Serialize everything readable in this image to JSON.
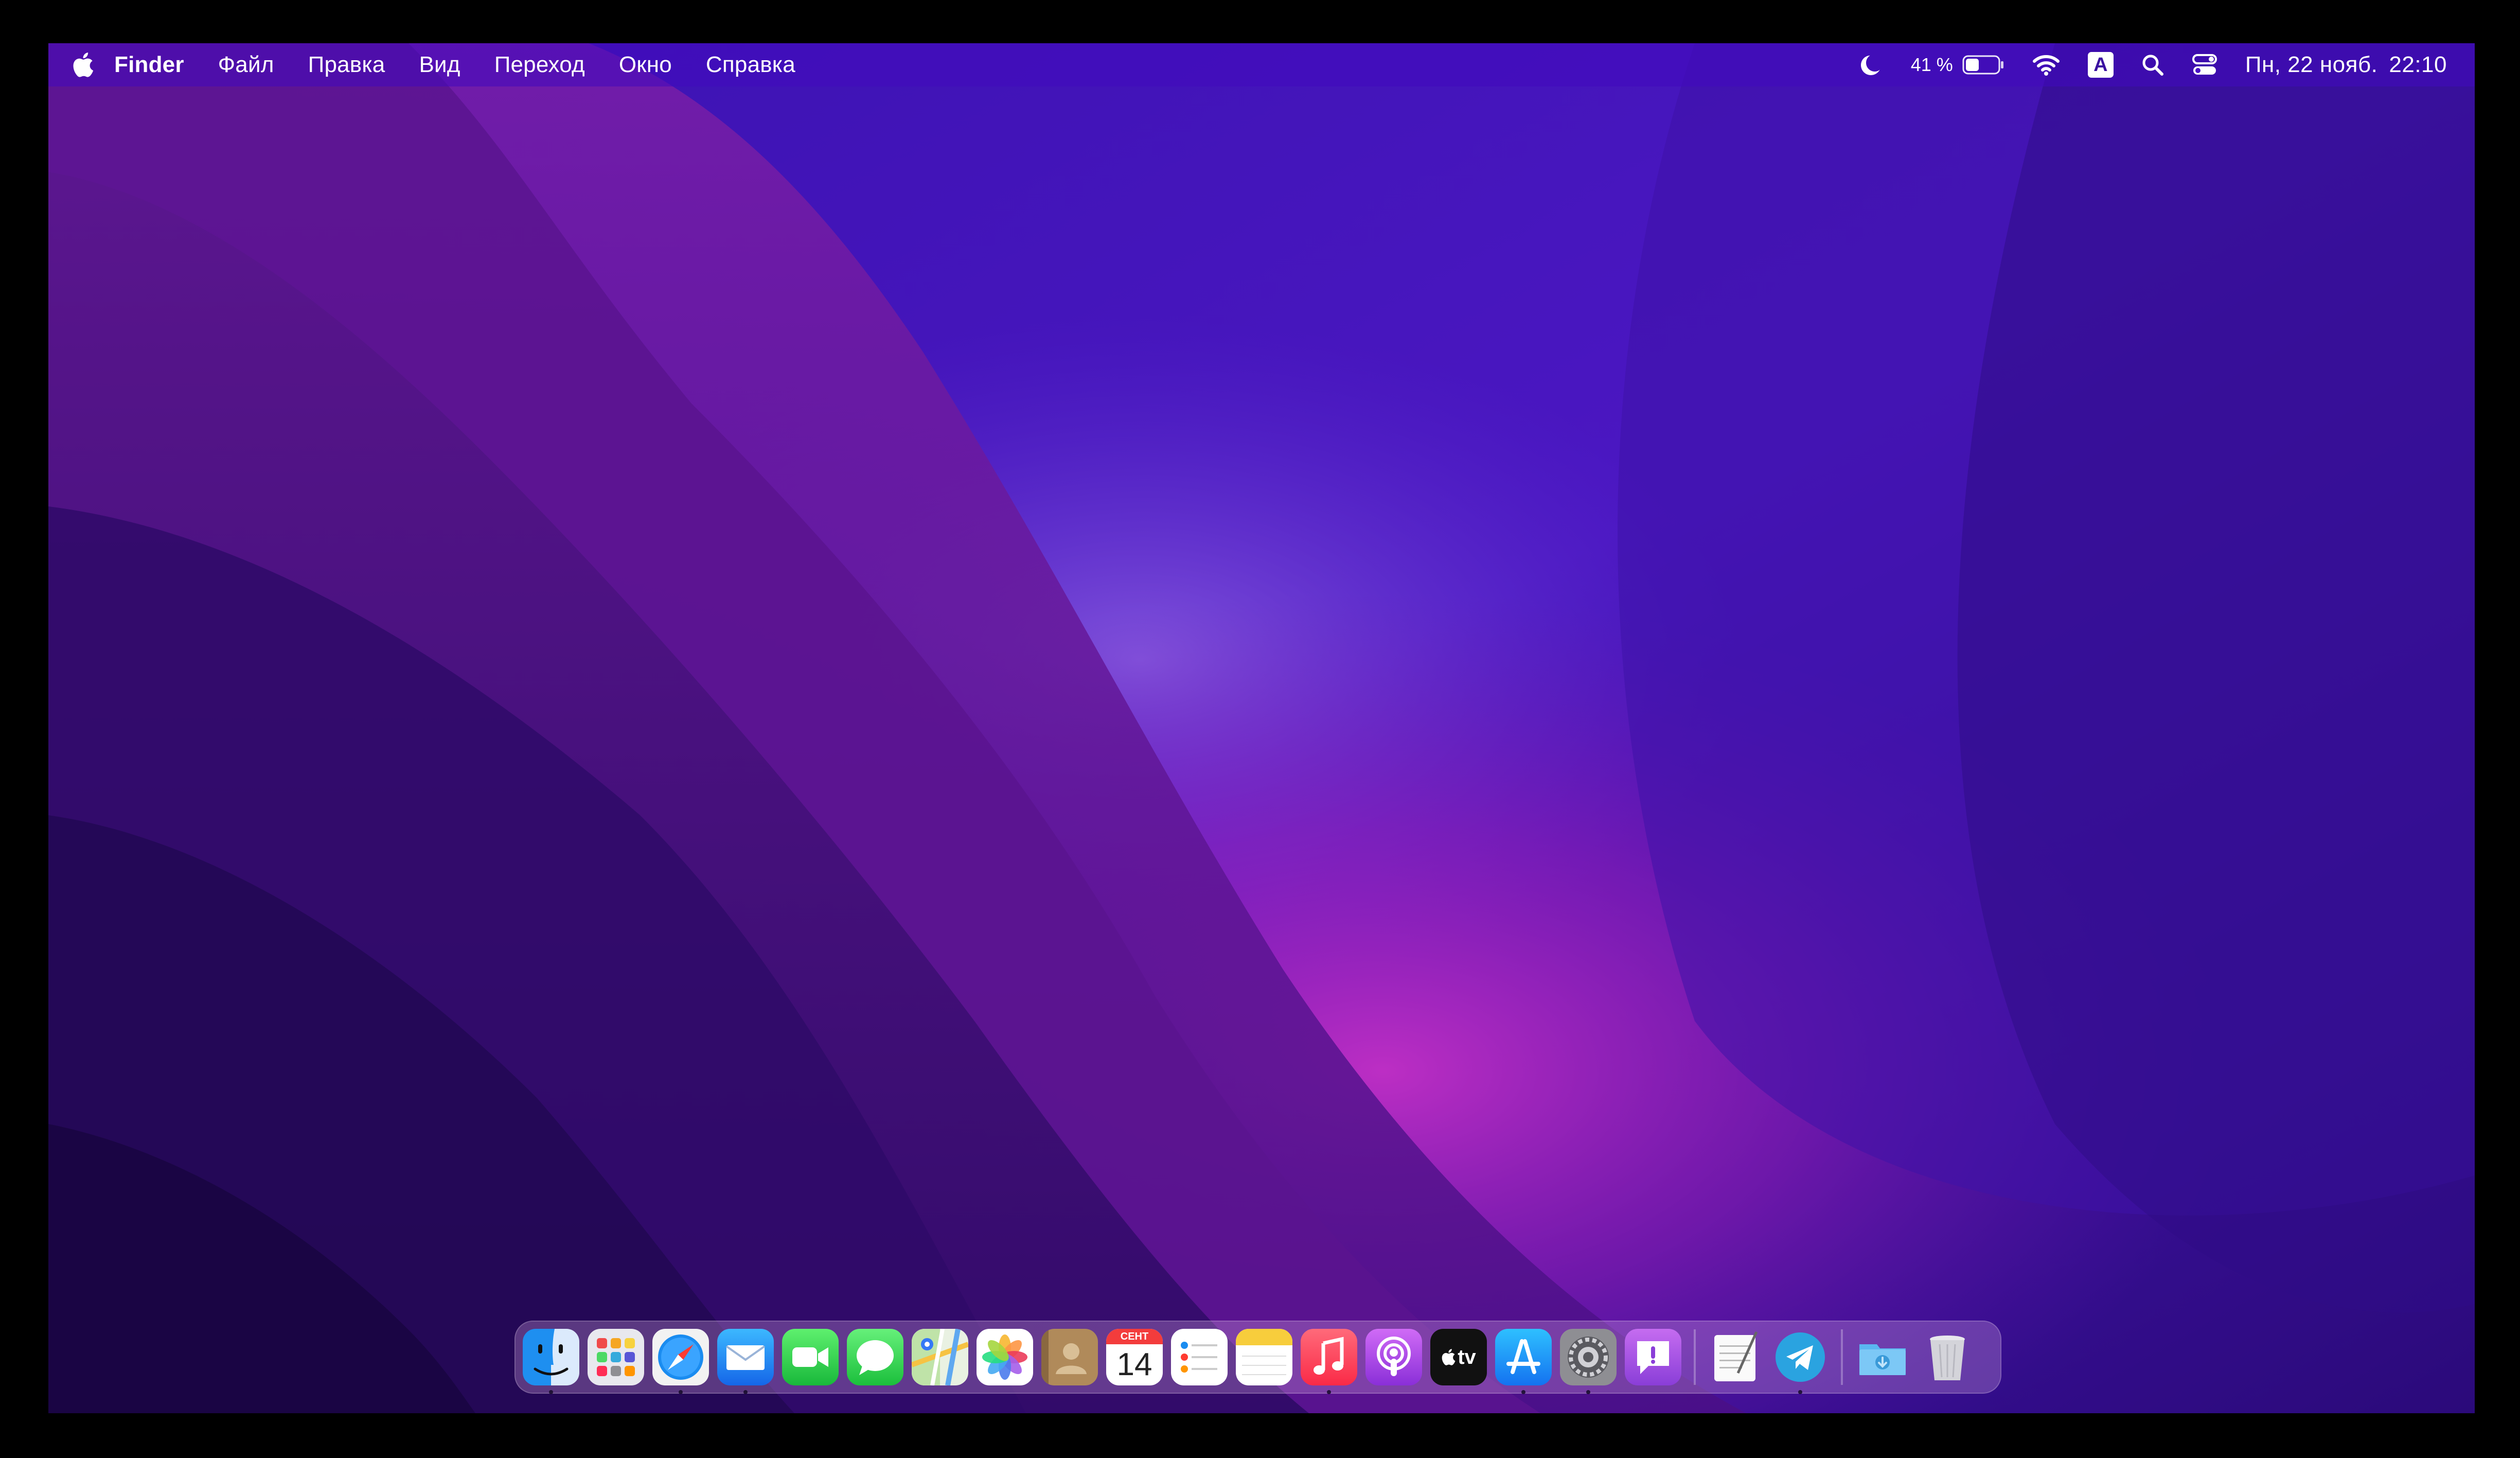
{
  "menubar": {
    "app_name": "Finder",
    "items": [
      "Файл",
      "Правка",
      "Вид",
      "Переход",
      "Окно",
      "Справка"
    ],
    "battery_percent": "41 %",
    "battery_level": 0.41,
    "input_source": "A",
    "date": "Пн, 22 нояб.",
    "time": "22:10"
  },
  "dock": {
    "calendar_month": "сент",
    "calendar_day": "14",
    "tv_label": "tv",
    "apps": [
      {
        "name": "Finder",
        "running": true
      },
      {
        "name": "Launchpad",
        "running": false
      },
      {
        "name": "Safari",
        "running": true
      },
      {
        "name": "Mail",
        "running": true
      },
      {
        "name": "FaceTime",
        "running": false
      },
      {
        "name": "Messages",
        "running": false
      },
      {
        "name": "Maps",
        "running": false
      },
      {
        "name": "Photos",
        "running": false
      },
      {
        "name": "Contacts",
        "running": false
      },
      {
        "name": "Calendar",
        "running": false
      },
      {
        "name": "Reminders",
        "running": false
      },
      {
        "name": "Notes",
        "running": false
      },
      {
        "name": "Music",
        "running": true
      },
      {
        "name": "Podcasts",
        "running": false
      },
      {
        "name": "TV",
        "running": false
      },
      {
        "name": "App Store",
        "running": true
      },
      {
        "name": "System Preferences",
        "running": true
      },
      {
        "name": "Feedback Assistant",
        "running": false
      },
      {
        "name": "TextEdit",
        "running": false
      },
      {
        "name": "Telegram",
        "running": true
      },
      {
        "name": "Downloads",
        "running": false
      },
      {
        "name": "Trash",
        "running": false
      }
    ]
  },
  "colors": {
    "wallpaper_dark": "#2a0b63",
    "wallpaper_mid": "#4a14a8",
    "wallpaper_magenta": "#a021b8",
    "menubar": "#4a12c4"
  }
}
